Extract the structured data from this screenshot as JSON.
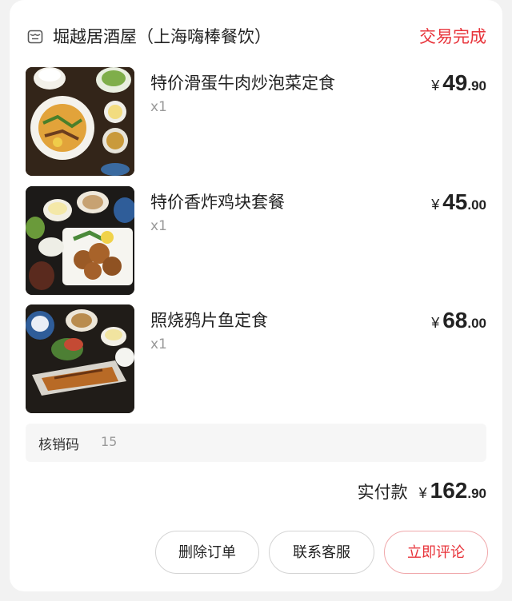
{
  "order": {
    "shop_icon": "shop-icon",
    "shop_name": "堀越居酒屋（上海嗨棒餐饮）",
    "status": "交易完成",
    "status_color": "#e8333a"
  },
  "items": [
    {
      "title": "特价滑蛋牛肉炒泡菜定食",
      "quantity": "x1",
      "price_symbol": "¥",
      "price_integer": "49",
      "price_decimal": ".90"
    },
    {
      "title": "特价香炸鸡块套餐",
      "quantity": "x1",
      "price_symbol": "¥",
      "price_integer": "45",
      "price_decimal": ".00"
    },
    {
      "title": "照烧鸦片鱼定食",
      "quantity": "x1",
      "price_symbol": "¥",
      "price_integer": "68",
      "price_decimal": ".00"
    }
  ],
  "verification": {
    "label": "核销码",
    "value": "15"
  },
  "payment": {
    "label": "实付款",
    "symbol": "¥",
    "integer": "162",
    "decimal": ".90"
  },
  "actions": {
    "delete": "删除订单",
    "contact": "联系客服",
    "review": "立即评论"
  }
}
